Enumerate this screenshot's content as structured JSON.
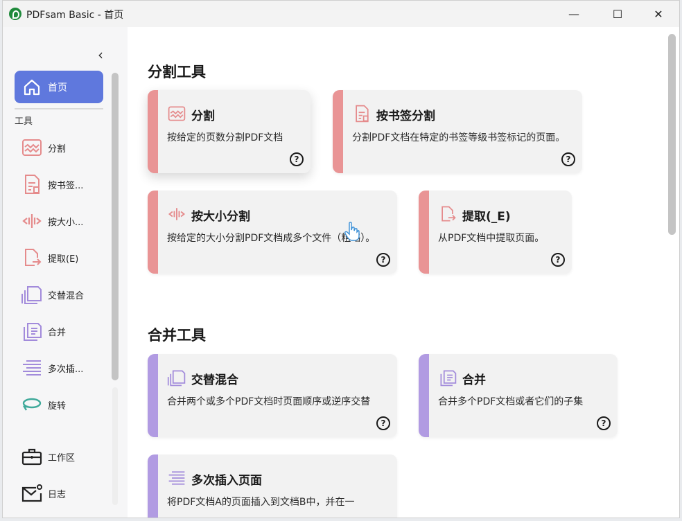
{
  "window": {
    "title": "PDFsam Basic - 首页",
    "controls": {
      "minimize": "—",
      "maximize": "☐",
      "close": "✕"
    }
  },
  "sidebar": {
    "collapse": "‹",
    "home_label": "首页",
    "section_label": "工具",
    "items": [
      {
        "label": "分割",
        "icon": "split-icon"
      },
      {
        "label": "按书签...",
        "icon": "bookmark-split-icon"
      },
      {
        "label": "按大小...",
        "icon": "size-split-icon"
      },
      {
        "label": "提取(E)",
        "icon": "extract-icon"
      },
      {
        "label": "交替混合",
        "icon": "alternate-mix-icon"
      },
      {
        "label": "合并",
        "icon": "merge-icon"
      },
      {
        "label": "多次插...",
        "icon": "multi-insert-icon"
      },
      {
        "label": "旋转",
        "icon": "rotate-icon"
      }
    ],
    "bottom": [
      {
        "label": "工作区",
        "icon": "briefcase-icon"
      },
      {
        "label": "日志",
        "icon": "log-icon"
      }
    ]
  },
  "main": {
    "split_heading": "分割工具",
    "merge_heading": "合并工具",
    "split_cards": [
      {
        "title": "分割",
        "desc": "按给定的页数分割PDF文档"
      },
      {
        "title": "按书签分割",
        "desc": "分割PDF文档在特定的书签等级书签标记的页面。"
      },
      {
        "title": "按大小分割",
        "desc": "按给定的大小分割PDF文档成多个文件（粗略）。"
      },
      {
        "title": "提取(_E)",
        "desc": "从PDF文档中提取页面。"
      }
    ],
    "merge_cards": [
      {
        "title": "交替混合",
        "desc": "合并两个或多个PDF文档时页面顺序或逆序交替"
      },
      {
        "title": "合并",
        "desc": "合并多个PDF文档或者它们的子集"
      },
      {
        "title": "多次插入页面",
        "desc": "将PDF文档A的页面插入到文档B中，并在一"
      }
    ],
    "help_glyph": "?"
  },
  "colors": {
    "accent": "#5f78dd",
    "split_bar": "#e99495",
    "merge_bar": "#b19be2",
    "rotate": "#3fa99a"
  }
}
